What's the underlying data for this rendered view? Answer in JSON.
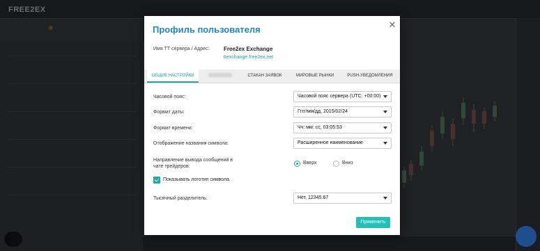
{
  "background": {
    "logo": "FREE2EX"
  },
  "modal": {
    "title": "Профиль пользователя",
    "close_icon": "close-icon",
    "server_label": "Имя ТТ сервера / Адрес:",
    "server_name": "Free2ex Exchange",
    "server_url": "ttexchange.free2ex.net",
    "tabs": [
      {
        "label": "ОБЩИЕ НАСТРОЙКИ",
        "active": true
      },
      {
        "label": "",
        "active": false
      },
      {
        "label": "СТАКАН ЗАЯВОК",
        "active": false
      },
      {
        "label": "МИРОВЫЕ РЫНКИ",
        "active": false
      },
      {
        "label": "PUSH-УВЕДОМЛЕНИЯ",
        "active": false
      }
    ],
    "settings": {
      "timezone": {
        "label": "Часовой пояс:",
        "value": "Часовой пояс сервера (UTC: +00:00)"
      },
      "date_format": {
        "label": "Формат даты:",
        "value": "Гггг/мм/дд, 2015/02/24"
      },
      "time_format": {
        "label": "Формат времени:",
        "value": "Чч: мм: сс, 03:05:53"
      },
      "symbol_name": {
        "label": "Отображение названия символа:",
        "value": "Расширенное наименование"
      },
      "chat_direction": {
        "label": "Направление вывода сообщений в чате трейдеров:",
        "options": [
          {
            "label": "Вверх",
            "checked": true
          },
          {
            "label": "Вниз",
            "checked": false
          }
        ]
      },
      "show_logo": {
        "label": "Показывать логотип символа",
        "checked": true
      },
      "thousands_separator": {
        "label": "Тысячный разделитель:",
        "value": "Нет, 12345.67"
      }
    },
    "apply_label": "Применить"
  },
  "colors": {
    "accent": "#1ea9a3",
    "title": "#1e88b8",
    "button": "#1ec3b8"
  }
}
